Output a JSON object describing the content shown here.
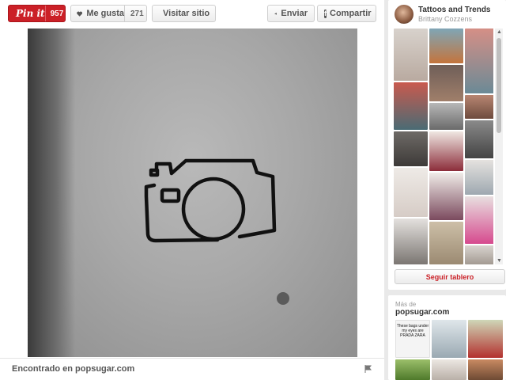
{
  "toolbar": {
    "pinit_label": "Pin it",
    "pinit_count": "957",
    "like_label": "Me gusta",
    "like_count": "271",
    "visit_label": "Visitar sitio",
    "send_label": "Enviar",
    "share_label": "Compartir"
  },
  "footer": {
    "found_label": "Encontrado en popsugar.com"
  },
  "board": {
    "title": "Tattoos and Trends",
    "user": "Brittany Cozzens",
    "follow_label": "Seguir tablero"
  },
  "more": {
    "from_label": "Más de",
    "site": "popsugar.com",
    "thumb_text": "These bags under my eyes are PRADA ZARA"
  },
  "colors": {
    "pin_red": "#cb2027",
    "button_border": "#cfcfcf"
  },
  "icons": [
    "heart-icon",
    "visit-site-icon",
    "send-icon",
    "facebook-icon",
    "flag-icon"
  ]
}
